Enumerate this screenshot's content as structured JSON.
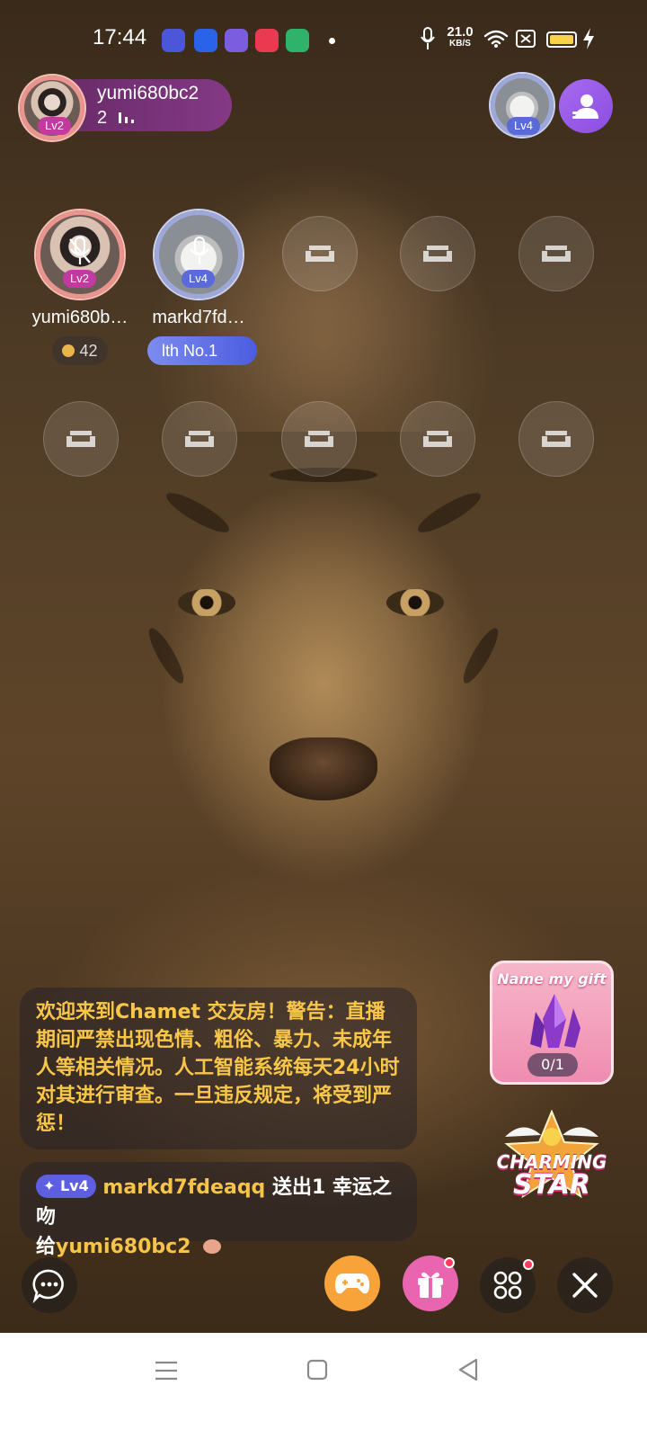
{
  "status_bar": {
    "time": "17:44",
    "network_speed": "21.0",
    "network_unit": "KB/S",
    "battery_color": "#f7d34a",
    "icons": [
      "notification-app-1",
      "baidu-app",
      "notification-app-2",
      "video-app",
      "security-app",
      "mic-icon",
      "wifi-icon",
      "sim-icon",
      "battery-icon",
      "charging-icon"
    ]
  },
  "host": {
    "name": "yumi680bc2",
    "online_count": "2",
    "level": "Lv2"
  },
  "owner": {
    "level": "Lv4"
  },
  "seats": [
    {
      "name": "yumi680b…",
      "level": "Lv2",
      "coins": "42"
    },
    {
      "name": "markd7fd…",
      "level": "Lv4",
      "rank_badge": "lth No.1"
    }
  ],
  "welcome_message": "欢迎来到Chamet 交友房！警告：直播期间严禁出现色情、粗俗、暴力、未成年人等相关情况。人工智能系统每天24小时对其进行审查。一旦违反规定，将受到严惩！",
  "gift_message": {
    "level": "Lv4",
    "sender": "markd7fdeaqq",
    "action": "送出1 幸运之吻",
    "to_word": "给",
    "receiver": "yumi680bc2"
  },
  "gift_card": {
    "title": "Name my gift",
    "progress": "0/1"
  },
  "charming_star": {
    "line1": "CHARMING",
    "line2": "STAR"
  },
  "colors": {
    "accent_purple": "#8b4de0",
    "game_button": "#f7a33a",
    "gift_button": "#e965b0",
    "chat_gold": "#f8c74a"
  }
}
